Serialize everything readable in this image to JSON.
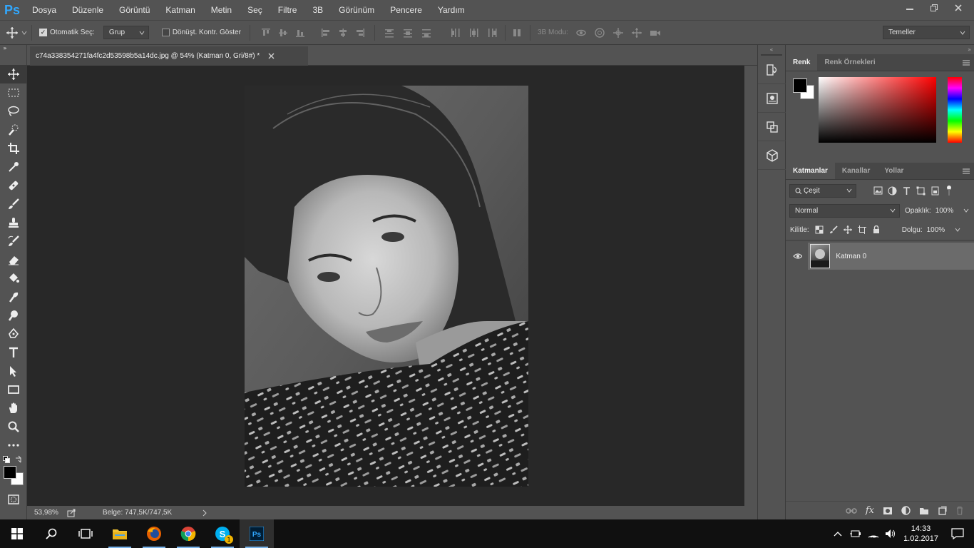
{
  "app": {
    "logo": "Ps"
  },
  "menu": [
    "Dosya",
    "Düzenle",
    "Görüntü",
    "Katman",
    "Metin",
    "Seç",
    "Filtre",
    "3B",
    "Görünüm",
    "Pencere",
    "Yardım"
  ],
  "options": {
    "auto_select_label": "Otomatik Seç:",
    "auto_select_value": "Grup",
    "transform_label": "Dönüşt. Kontr. Göster",
    "mode3d_label": "3B Modu:",
    "workspace": "Temeller"
  },
  "document": {
    "tab_title": "c74a338354271fa4fc2d53598b5a14dc.jpg @ 54% (Katman 0, Gri/8#) *",
    "zoom": "53,98%",
    "doc_size": "Belge: 747,5K/747,5K"
  },
  "color_panel": {
    "tabs": [
      "Renk",
      "Renk Örnekleri"
    ]
  },
  "layers_panel": {
    "tabs": [
      "Katmanlar",
      "Kanallar",
      "Yollar"
    ],
    "filter_kind": "Çeşit",
    "blend_mode": "Normal",
    "opacity_label": "Opaklık:",
    "opacity_value": "100%",
    "lock_label": "Kilitle:",
    "fill_label": "Dolgu:",
    "fill_value": "100%",
    "layers": [
      {
        "name": "Katman 0"
      }
    ]
  },
  "taskbar": {
    "time": "14:33",
    "date": "1.02.2017",
    "skype_badge": "1"
  },
  "colors": {
    "ui_bg": "#535353",
    "canvas_bg": "#282828",
    "accent": "#31a8ff"
  }
}
